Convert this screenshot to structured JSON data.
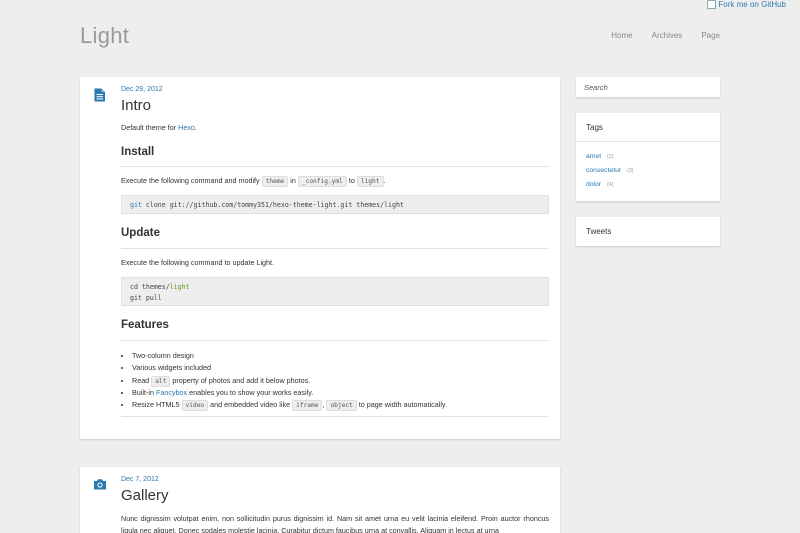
{
  "fork": {
    "alt": "Fork me on GitHub"
  },
  "site": {
    "title": "Light",
    "nav": [
      {
        "label": "Home"
      },
      {
        "label": "Archives"
      },
      {
        "label": "Page"
      }
    ]
  },
  "posts": [
    {
      "date": "Dec 29, 2012",
      "title": "Intro",
      "icon": "document-icon",
      "intro_prefix": "Default theme for ",
      "intro_link": "Hexo",
      "intro_suffix": ".",
      "install_heading": "Install",
      "install_text_1": "Execute the following command and modify ",
      "install_code_1": "theme",
      "install_text_2": " in ",
      "install_code_2": "_config.yml",
      "install_text_3": " to ",
      "install_code_3": "light",
      "install_text_4": ".",
      "install_cmd_kw": "git",
      "install_cmd_rest": " clone git://github.com/tommy351/hexo-theme-light.git themes/light",
      "update_heading": "Update",
      "update_text": "Execute the following command to update Light.",
      "update_line1_prefix": "cd themes/",
      "update_line1_hl": "light",
      "update_line2": "git pull",
      "features_heading": "Features",
      "features": {
        "f1": "Two-column design",
        "f2": "Various widgets included",
        "f3_a": "Read ",
        "f3_code": "alt",
        "f3_b": " property of photos and add it below photos.",
        "f4_a": "Built-in ",
        "f4_link": "Fancybox",
        "f4_b": " enables you to show your works easily.",
        "f5_a": "Resize HTML5 ",
        "f5_code1": "video",
        "f5_b": " and embedded video like ",
        "f5_code2": "iframe",
        "f5_c": ", ",
        "f5_code3": "object",
        "f5_d": " to page width automatically."
      }
    },
    {
      "date": "Dec 7, 2012",
      "title": "Gallery",
      "icon": "camera-icon",
      "excerpt": "Nunc dignissim volutpat enim, non sollicitudin purus dignissim id. Nam sit amet urna eu velit lacinia eleifend. Proin auctor rhoncus ligula nec aliquet. Donec sodales molestie lacinia. Curabitur dictum faucibus urna at convallis. Aliquam in lectus at urna"
    }
  ],
  "sidebar": {
    "search_placeholder": "Search",
    "tags_title": "Tags",
    "tags": [
      {
        "name": "amet",
        "count": "(2)"
      },
      {
        "name": "consectetur",
        "count": "(3)"
      },
      {
        "name": "dolor",
        "count": "(4)"
      }
    ],
    "tweets_title": "Tweets"
  },
  "colors": {
    "link": "#2a7ab0",
    "background": "#eeeeee",
    "card": "#ffffff",
    "code_highlight": "#6a9a1f"
  }
}
